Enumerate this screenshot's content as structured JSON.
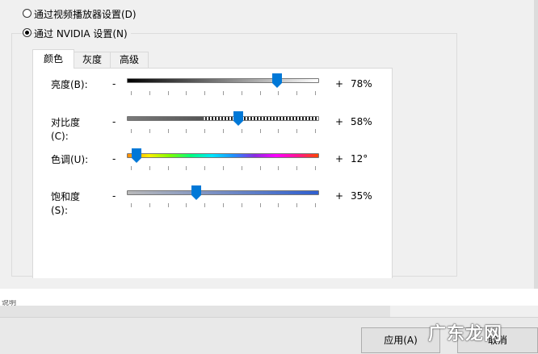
{
  "radios": {
    "video_player": {
      "label": "通过视频播放器设置(D)",
      "checked": false
    },
    "nvidia": {
      "label": "通过 NVIDIA 设置(N)",
      "checked": true
    }
  },
  "tabs": [
    {
      "label": "颜色",
      "active": true
    },
    {
      "label": "灰度",
      "active": false
    },
    {
      "label": "高级",
      "active": false
    }
  ],
  "sliders": [
    {
      "key": "brightness",
      "label": "亮度(B):",
      "minus": "-",
      "plus": "+",
      "value": "78%",
      "level": 0.78,
      "colors": {
        "start": "#000000",
        "end": "#ffffff"
      }
    },
    {
      "key": "contrast",
      "label": "对比度 (C):",
      "minus": "-",
      "plus": "+",
      "value": "58%",
      "level": 0.58,
      "colors": {
        "start": "#6f6f6f",
        "end": "#101010"
      }
    },
    {
      "key": "hue",
      "label": "色调(U):",
      "minus": "-",
      "plus": "+",
      "value": "12°",
      "level": 0.05,
      "colors": {
        "start": "#ff8c00",
        "end": "#ff4500"
      }
    },
    {
      "key": "saturation",
      "label": "饱和度 (S):",
      "minus": "-",
      "plus": "+",
      "value": "35%",
      "level": 0.36,
      "colors": {
        "start": "#b9b9b9",
        "end": "#2f5fd0"
      }
    }
  ],
  "footer": {
    "apply_label": "应用(A)",
    "cancel_label": "取消",
    "truncated_label": "说明"
  },
  "watermark": "广东龙网",
  "accent": "#0078d7"
}
